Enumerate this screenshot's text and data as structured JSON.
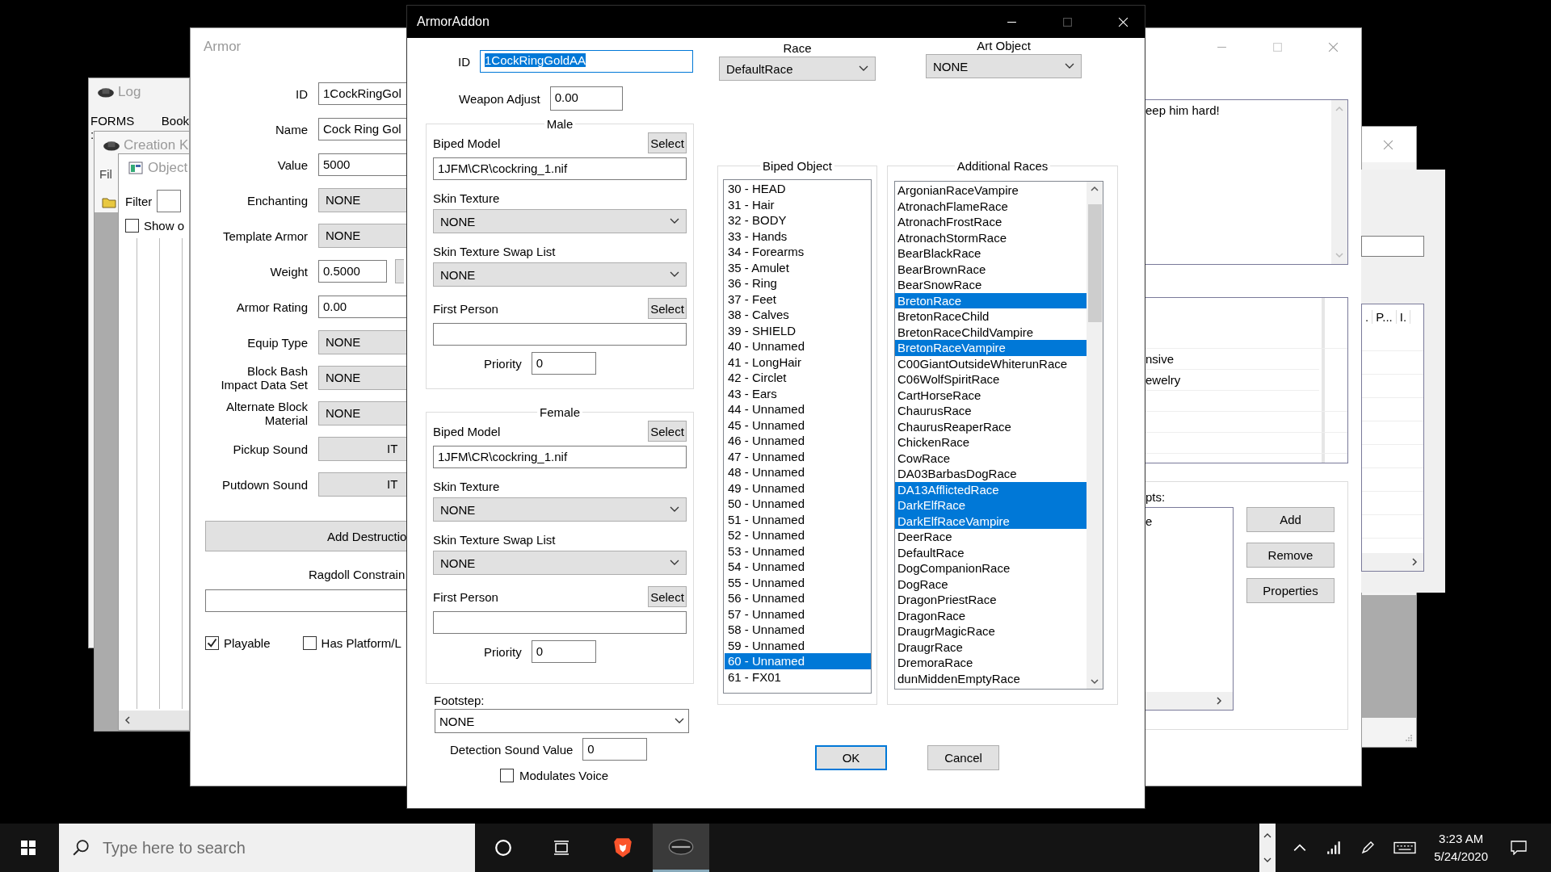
{
  "log_window": {
    "title": "Log",
    "line": "FORMS :",
    "line_2": "Book"
  },
  "ck_window": {
    "title": "Creation K",
    "menu": "Fil"
  },
  "object_window": {
    "title": "Object",
    "filter_label": "Filter",
    "show_only": {
      "label": "Show o",
      "checked": false
    }
  },
  "armor_window": {
    "title": "Armor",
    "fields": [
      {
        "label": "ID",
        "value": "1CockRingGol",
        "kind": "text"
      },
      {
        "label": "Name",
        "value": "Cock Ring Gol",
        "kind": "text"
      },
      {
        "label": "Value",
        "value": "5000",
        "kind": "text"
      },
      {
        "label": "Enchanting",
        "value": "NONE",
        "kind": "combo"
      },
      {
        "label": "Template Armor",
        "value": "NONE",
        "kind": "combo"
      },
      {
        "label": "Weight",
        "value": "0.5000",
        "kind": "weight"
      },
      {
        "label": "Armor Rating",
        "value": "0.00",
        "kind": "text"
      },
      {
        "label": "Equip Type",
        "value": "NONE",
        "kind": "combo"
      },
      {
        "label": "Block Bash\nImpact Data Set",
        "value": "NONE",
        "kind": "combo"
      },
      {
        "label": "Alternate Block\nMaterial",
        "value": "NONE",
        "kind": "combo"
      },
      {
        "label": "Pickup Sound",
        "value": "IT",
        "kind": "button"
      },
      {
        "label": "Putdown Sound",
        "value": "IT",
        "kind": "button"
      }
    ],
    "add_destruction": "Add Destructio",
    "ragdoll_label": "Ragdoll Constrain",
    "checkboxes": [
      {
        "label": "Playable",
        "checked": true
      },
      {
        "label": "Has Platform/L",
        "checked": false
      }
    ],
    "description": "eep him hard!",
    "keywords": [
      "nsive",
      "ewelry"
    ],
    "scripts_label": "pts:",
    "scripts": [
      "e"
    ],
    "buttons": [
      "Add",
      "Remove",
      "Properties"
    ]
  },
  "other_window": {
    "columns": [
      ".",
      "P...",
      "I."
    ]
  },
  "dialog": {
    "title": "ArmorAddon",
    "id_label": "ID",
    "id_value": "1CockRingGoldAA",
    "weapon_adjust_label": "Weapon Adjust",
    "weapon_adjust": "0.00",
    "genders": [
      {
        "title": "Male",
        "model_label": "Biped Model",
        "model_select": "Select",
        "model": "1JFM\\CR\\cockring_1.nif",
        "skin_label": "Skin Texture",
        "skin": "NONE",
        "swap_label": "Skin Texture Swap List",
        "swap": "NONE",
        "first_label": "First Person",
        "first_select": "Select",
        "priority_label": "Priority",
        "priority": "0"
      },
      {
        "title": "Female",
        "model_label": "Biped Model",
        "model_select": "Select",
        "model": "1JFM\\CR\\cockring_1.nif",
        "skin_label": "Skin Texture",
        "skin": "NONE",
        "swap_label": "Skin Texture Swap List",
        "swap": "NONE",
        "first_label": "First Person",
        "first_select": "Select",
        "priority_label": "Priority",
        "priority": "0"
      }
    ],
    "footstep_label": "Footstep:",
    "footstep": "NONE",
    "detection_label": "Detection Sound Value",
    "detection": "0",
    "modulates": {
      "label": "Modulates Voice",
      "checked": false
    },
    "race_label": "Race",
    "race": "DefaultRace",
    "art_label": "Art Object",
    "art": "NONE",
    "biped_title": "Biped Object",
    "biped_slots": [
      {
        "label": "30 - HEAD",
        "selected": false
      },
      {
        "label": "31 - Hair",
        "selected": false
      },
      {
        "label": "32 - BODY",
        "selected": false
      },
      {
        "label": "33 - Hands",
        "selected": false
      },
      {
        "label": "34 - Forearms",
        "selected": false
      },
      {
        "label": "35 - Amulet",
        "selected": false
      },
      {
        "label": "36 - Ring",
        "selected": false
      },
      {
        "label": "37 - Feet",
        "selected": false
      },
      {
        "label": "38 - Calves",
        "selected": false
      },
      {
        "label": "39 - SHIELD",
        "selected": false
      },
      {
        "label": "40 - Unnamed",
        "selected": false
      },
      {
        "label": "41 - LongHair",
        "selected": false
      },
      {
        "label": "42 - Circlet",
        "selected": false
      },
      {
        "label": "43 - Ears",
        "selected": false
      },
      {
        "label": "44 - Unnamed",
        "selected": false
      },
      {
        "label": "45 - Unnamed",
        "selected": false
      },
      {
        "label": "46 - Unnamed",
        "selected": false
      },
      {
        "label": "47 - Unnamed",
        "selected": false
      },
      {
        "label": "48 - Unnamed",
        "selected": false
      },
      {
        "label": "49 - Unnamed",
        "selected": false
      },
      {
        "label": "50 - Unnamed",
        "selected": false
      },
      {
        "label": "51 - Unnamed",
        "selected": false
      },
      {
        "label": "52 - Unnamed",
        "selected": false
      },
      {
        "label": "53 - Unnamed",
        "selected": false
      },
      {
        "label": "54 - Unnamed",
        "selected": false
      },
      {
        "label": "55 - Unnamed",
        "selected": false
      },
      {
        "label": "56 - Unnamed",
        "selected": false
      },
      {
        "label": "57 - Unnamed",
        "selected": false
      },
      {
        "label": "58 - Unnamed",
        "selected": false
      },
      {
        "label": "59 - Unnamed",
        "selected": false
      },
      {
        "label": "60 - Unnamed",
        "selected": true
      },
      {
        "label": "61 - FX01",
        "selected": false
      }
    ],
    "races_title": "Additional Races",
    "races": [
      {
        "label": "ArgonianRaceVampire",
        "selected": false
      },
      {
        "label": "AtronachFlameRace",
        "selected": false
      },
      {
        "label": "AtronachFrostRace",
        "selected": false
      },
      {
        "label": "AtronachStormRace",
        "selected": false
      },
      {
        "label": "BearBlackRace",
        "selected": false
      },
      {
        "label": "BearBrownRace",
        "selected": false
      },
      {
        "label": "BearSnowRace",
        "selected": false
      },
      {
        "label": "BretonRace",
        "selected": true
      },
      {
        "label": "BretonRaceChild",
        "selected": false
      },
      {
        "label": "BretonRaceChildVampire",
        "selected": false
      },
      {
        "label": "BretonRaceVampire",
        "selected": true
      },
      {
        "label": "C00GiantOutsideWhiterunRace",
        "selected": false
      },
      {
        "label": "C06WolfSpiritRace",
        "selected": false
      },
      {
        "label": "CartHorseRace",
        "selected": false
      },
      {
        "label": "ChaurusRace",
        "selected": false
      },
      {
        "label": "ChaurusReaperRace",
        "selected": false
      },
      {
        "label": "ChickenRace",
        "selected": false
      },
      {
        "label": "CowRace",
        "selected": false
      },
      {
        "label": "DA03BarbasDogRace",
        "selected": false
      },
      {
        "label": "DA13AfflictedRace",
        "selected": true
      },
      {
        "label": "DarkElfRace",
        "selected": true
      },
      {
        "label": "DarkElfRaceVampire",
        "selected": true
      },
      {
        "label": "DeerRace",
        "selected": false
      },
      {
        "label": "DefaultRace",
        "selected": false
      },
      {
        "label": "DogCompanionRace",
        "selected": false
      },
      {
        "label": "DogRace",
        "selected": false
      },
      {
        "label": "DragonPriestRace",
        "selected": false
      },
      {
        "label": "DragonRace",
        "selected": false
      },
      {
        "label": "DraugrMagicRace",
        "selected": false
      },
      {
        "label": "DraugrRace",
        "selected": false
      },
      {
        "label": "DremoraRace",
        "selected": false
      },
      {
        "label": "dunMiddenEmptyRace",
        "selected": false
      }
    ],
    "ok": "OK",
    "cancel": "Cancel"
  },
  "taskbar": {
    "search_placeholder": "Type here to search",
    "time": "3:23 AM",
    "date": "5/24/2020"
  }
}
